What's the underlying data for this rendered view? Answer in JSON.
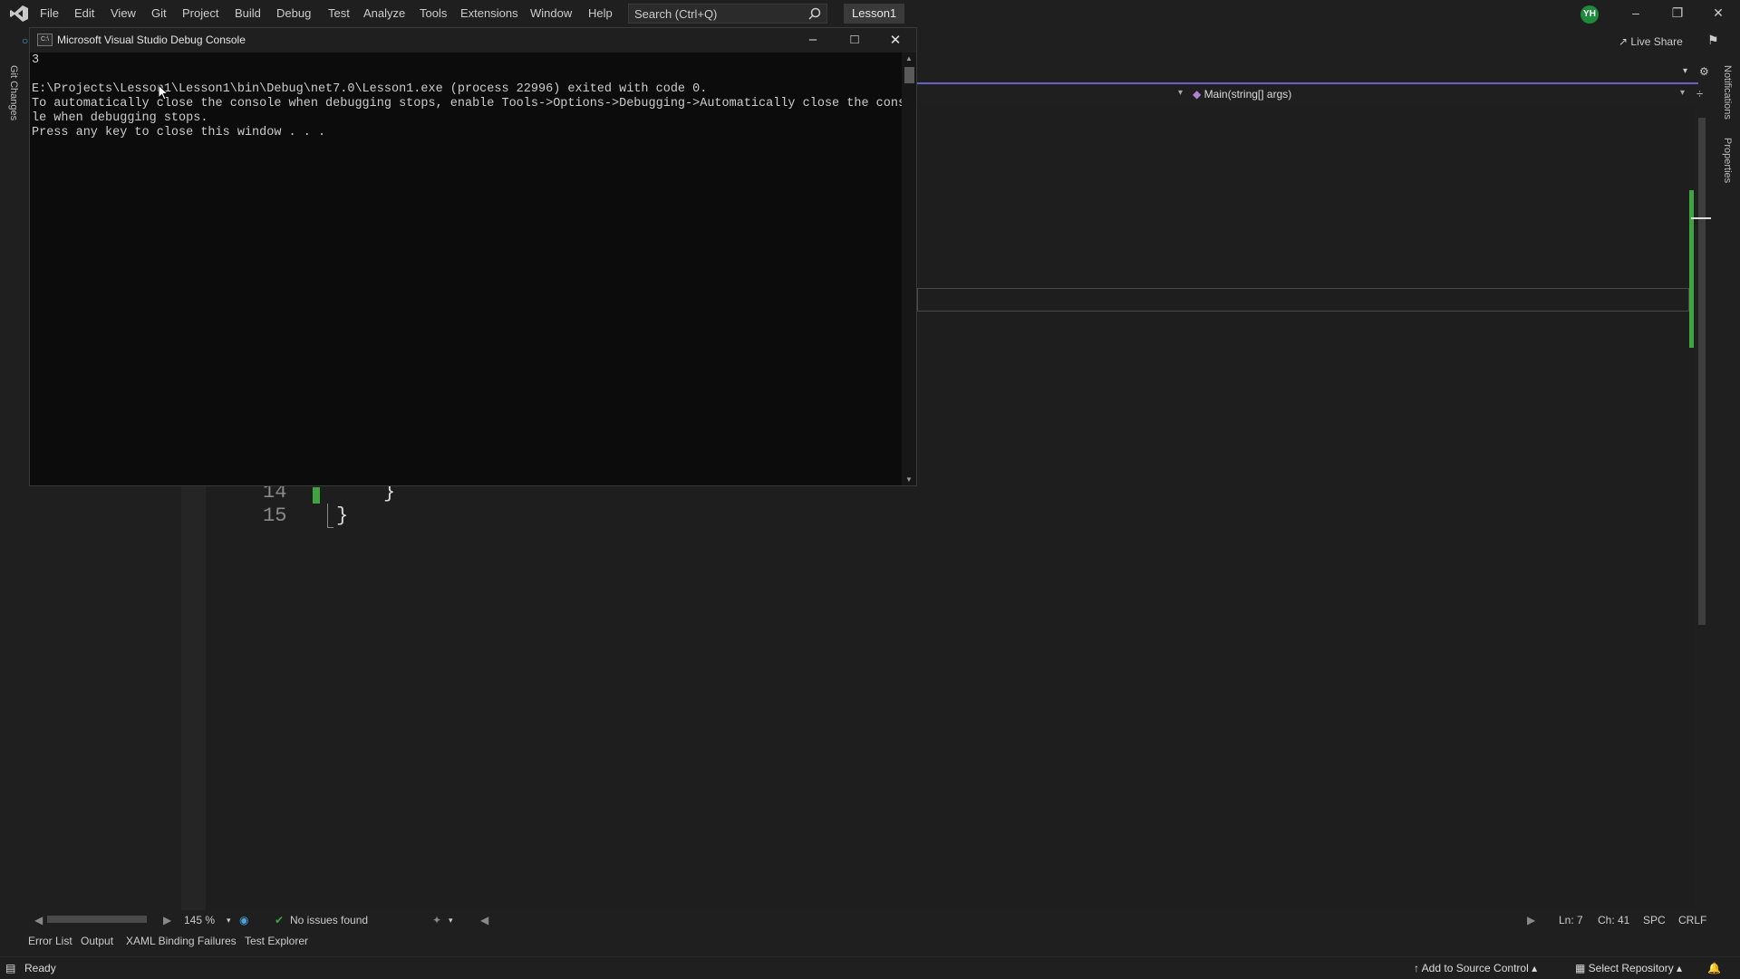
{
  "menu": {
    "items": [
      "File",
      "Edit",
      "View",
      "Git",
      "Project",
      "Build",
      "Debug",
      "Test",
      "Analyze",
      "Tools",
      "Extensions",
      "Window",
      "Help"
    ],
    "search_placeholder": "Search (Ctrl+Q)",
    "solution_name": "Lesson1",
    "avatar_initials": "YH"
  },
  "toolbar": {
    "live_share": "Live Share"
  },
  "side_tabs": {
    "left": "Git Changes",
    "right_top": "Notifications",
    "right_bottom": "Properties"
  },
  "editor": {
    "nav_method": "Main(string[] args)",
    "lines": [
      {
        "num": "14",
        "code": "}"
      },
      {
        "num": "15",
        "code": "}"
      }
    ]
  },
  "editor_status": {
    "zoom": "145 %",
    "issues": "No issues found",
    "line": "Ln: 7",
    "col": "Ch: 41",
    "whitespace": "SPC",
    "line_ending": "CRLF"
  },
  "bottom_tabs": [
    "Error List",
    "Output",
    "XAML Binding Failures",
    "Test Explorer"
  ],
  "status_bar": {
    "ready": "Ready",
    "source_control": "Add to Source Control",
    "repository": "Select Repository"
  },
  "console": {
    "title": "Microsoft Visual Studio Debug Console",
    "output": "3\n\nE:\\Projects\\Lesson1\\Lesson1\\bin\\Debug\\net7.0\\Lesson1.exe (process 22996) exited with code 0.\nTo automatically close the console when debugging stops, enable Tools->Options->Debugging->Automatically close the conso\nle when debugging stops.\nPress any key to close this window . . ."
  },
  "colors": {
    "accent": "#6a5fc1",
    "success": "#3fa33f",
    "avatar": "#1e8a3c"
  }
}
